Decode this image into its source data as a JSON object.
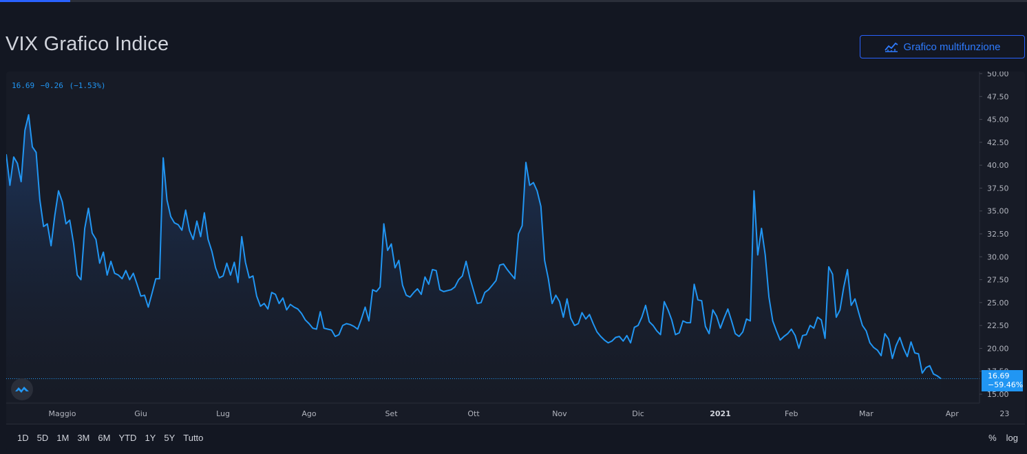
{
  "page": {
    "title": "VIX Grafico Indice",
    "cta_label": "Grafico multifunzione",
    "cta_icon": "chart-line-icon"
  },
  "legend": {
    "last": "16.69",
    "change": "−0.26",
    "change_pct": "(−1.53%)"
  },
  "last_tag": {
    "value": "16.69",
    "pct": "−59.46%"
  },
  "range_buttons": [
    "1D",
    "5D",
    "1M",
    "3M",
    "6M",
    "YTD",
    "1Y",
    "5Y",
    "Tutto"
  ],
  "scale_buttons": [
    "%",
    "log"
  ],
  "colors": {
    "line": "#2196f3",
    "background": "#171b26",
    "accent": "#2962ff"
  },
  "chart_data": {
    "type": "area",
    "ylim": [
      15.0,
      50.0
    ],
    "yticks": [
      "50.00",
      "47.50",
      "45.00",
      "42.50",
      "40.00",
      "37.50",
      "35.00",
      "32.50",
      "30.00",
      "27.50",
      "25.00",
      "22.50",
      "20.00",
      "17.50",
      "15.00"
    ],
    "ytick_values": [
      50,
      47.5,
      45,
      42.5,
      40,
      37.5,
      35,
      32.5,
      30,
      27.5,
      25,
      22.5,
      20,
      17.5,
      15
    ],
    "xticks": [
      {
        "label": "Maggio",
        "idx": 15,
        "bold": false
      },
      {
        "label": "Giu",
        "idx": 36,
        "bold": false
      },
      {
        "label": "Lug",
        "idx": 58,
        "bold": false
      },
      {
        "label": "Ago",
        "idx": 81,
        "bold": false
      },
      {
        "label": "Set",
        "idx": 103,
        "bold": false
      },
      {
        "label": "Ott",
        "idx": 125,
        "bold": false
      },
      {
        "label": "Nov",
        "idx": 148,
        "bold": false
      },
      {
        "label": "Dic",
        "idx": 169,
        "bold": false
      },
      {
        "label": "2021",
        "idx": 191,
        "bold": true
      },
      {
        "label": "Feb",
        "idx": 210,
        "bold": false
      },
      {
        "label": "Mar",
        "idx": 230,
        "bold": false
      },
      {
        "label": "Apr",
        "idx": 253,
        "bold": false
      },
      {
        "label": "23",
        "idx": 267,
        "bold": false
      }
    ],
    "last_value": 16.69,
    "values": [
      41.2,
      37.8,
      40.9,
      40.2,
      38.2,
      43.8,
      45.5,
      42.0,
      41.4,
      36.2,
      33.3,
      33.6,
      31.2,
      34.5,
      37.2,
      36.0,
      33.6,
      34.0,
      31.5,
      28.0,
      27.5,
      33.1,
      35.3,
      32.6,
      31.9,
      29.3,
      30.5,
      28.0,
      29.5,
      28.2,
      28.0,
      27.6,
      28.5,
      27.5,
      28.2,
      27.0,
      25.7,
      25.8,
      24.5,
      26.0,
      27.6,
      27.6,
      40.8,
      36.2,
      34.4,
      33.7,
      33.5,
      32.9,
      35.1,
      32.9,
      31.9,
      33.9,
      32.2,
      34.8,
      31.9,
      30.6,
      28.8,
      27.7,
      27.9,
      29.3,
      28.0,
      29.4,
      27.2,
      32.2,
      29.4,
      27.7,
      27.9,
      25.7,
      24.6,
      24.9,
      24.3,
      26.1,
      25.9,
      24.9,
      25.5,
      24.2,
      24.8,
      24.5,
      24.3,
      23.8,
      23.1,
      22.7,
      22.2,
      22.1,
      24.0,
      22.2,
      22.1,
      22.0,
      21.3,
      21.5,
      22.5,
      22.7,
      22.6,
      22.4,
      22.1,
      23.2,
      24.5,
      23.0,
      26.4,
      26.2,
      26.7,
      33.6,
      30.7,
      31.4,
      28.8,
      29.6,
      26.9,
      25.8,
      25.6,
      26.1,
      26.5,
      25.9,
      27.8,
      27.0,
      28.6,
      28.5,
      26.4,
      26.2,
      26.3,
      26.4,
      26.7,
      27.5,
      27.9,
      29.5,
      27.7,
      26.3,
      24.9,
      25.0,
      26.1,
      26.4,
      26.9,
      27.4,
      29.1,
      29.2,
      28.6,
      28.1,
      27.6,
      32.5,
      33.4,
      40.3,
      37.8,
      38.1,
      37.2,
      35.5,
      29.6,
      27.6,
      24.9,
      25.8,
      25.1,
      23.4,
      25.4,
      23.3,
      22.5,
      22.7,
      23.9,
      23.2,
      23.7,
      22.7,
      21.8,
      21.3,
      20.9,
      20.6,
      20.8,
      21.2,
      21.3,
      20.8,
      21.4,
      20.6,
      22.3,
      22.5,
      23.4,
      24.7,
      22.9,
      22.5,
      21.9,
      21.5,
      25.1,
      24.2,
      23.1,
      21.5,
      21.7,
      23.0,
      22.8,
      22.8,
      27.0,
      25.3,
      25.2,
      22.4,
      21.6,
      24.2,
      23.5,
      22.2,
      23.3,
      24.3,
      23.0,
      21.6,
      21.3,
      21.8,
      23.2,
      23.0,
      37.2,
      30.2,
      33.1,
      30.2,
      25.6,
      23.0,
      21.9,
      20.9,
      21.3,
      21.6,
      22.1,
      21.4,
      20.0,
      21.4,
      21.5,
      22.5,
      22.2,
      23.4,
      23.1,
      21.1,
      28.9,
      28.1,
      23.4,
      24.2,
      26.7,
      28.6,
      24.7,
      25.4,
      23.9,
      22.5,
      21.9,
      20.6,
      20.1,
      19.8,
      19.2,
      21.6,
      21.0,
      18.9,
      20.3,
      21.2,
      20.0,
      19.1,
      20.7,
      19.5,
      19.4,
      17.3,
      17.9,
      18.1,
      17.2,
      17.0,
      16.69
    ]
  }
}
